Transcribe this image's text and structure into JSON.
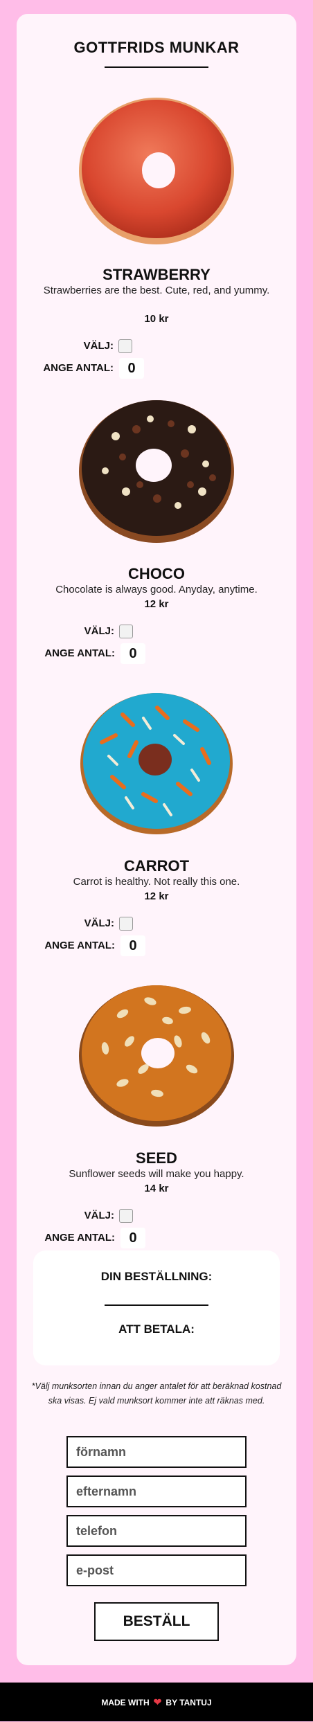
{
  "title": "GOTTFRIDS MUNKAR",
  "donuts": [
    {
      "name": "STRAWBERRY",
      "description": "Strawberries are the best. Cute, red, and yummy.",
      "price": "10 kr",
      "choose_label": "VÄLJ:",
      "qty_label": "ANGE ANTAL:",
      "qty": "0"
    },
    {
      "name": "CHOCO",
      "description": "Chocolate is always good. Anyday, anytime.",
      "price": "12 kr",
      "choose_label": "VÄLJ:",
      "qty_label": "ANGE ANTAL:",
      "qty": "0"
    },
    {
      "name": "CARROT",
      "description": "Carrot is healthy. Not really this one.",
      "price": "12 kr",
      "choose_label": "VÄLJ:",
      "qty_label": "ANGE ANTAL:",
      "qty": "0"
    },
    {
      "name": "SEED",
      "description": "Sunflower seeds will make you happy.",
      "price": "14 kr",
      "choose_label": "VÄLJ:",
      "qty_label": "ANGE ANTAL:",
      "qty": "0"
    }
  ],
  "summary": {
    "order_heading": "DIN BESTÄLLNING:",
    "pay_heading": "ATT BETALA:"
  },
  "note": "*Välj munksorten innan du anger antalet för att beräknad kostnad ska visas. Ej vald munksort kommer inte att räknas med.",
  "form": {
    "firstname_placeholder": "förnamn",
    "lastname_placeholder": "efternamn",
    "phone_placeholder": "telefon",
    "email_placeholder": "e-post",
    "submit_label": "BESTÄLL"
  },
  "footer": {
    "made_with": "MADE WITH",
    "by": "BY TANTUJ",
    "heart_icon": "heart-icon"
  },
  "colors": {
    "background": "#ffbde8",
    "card": "#fff4fb",
    "footer": "#000000",
    "heart": "#e63946"
  }
}
